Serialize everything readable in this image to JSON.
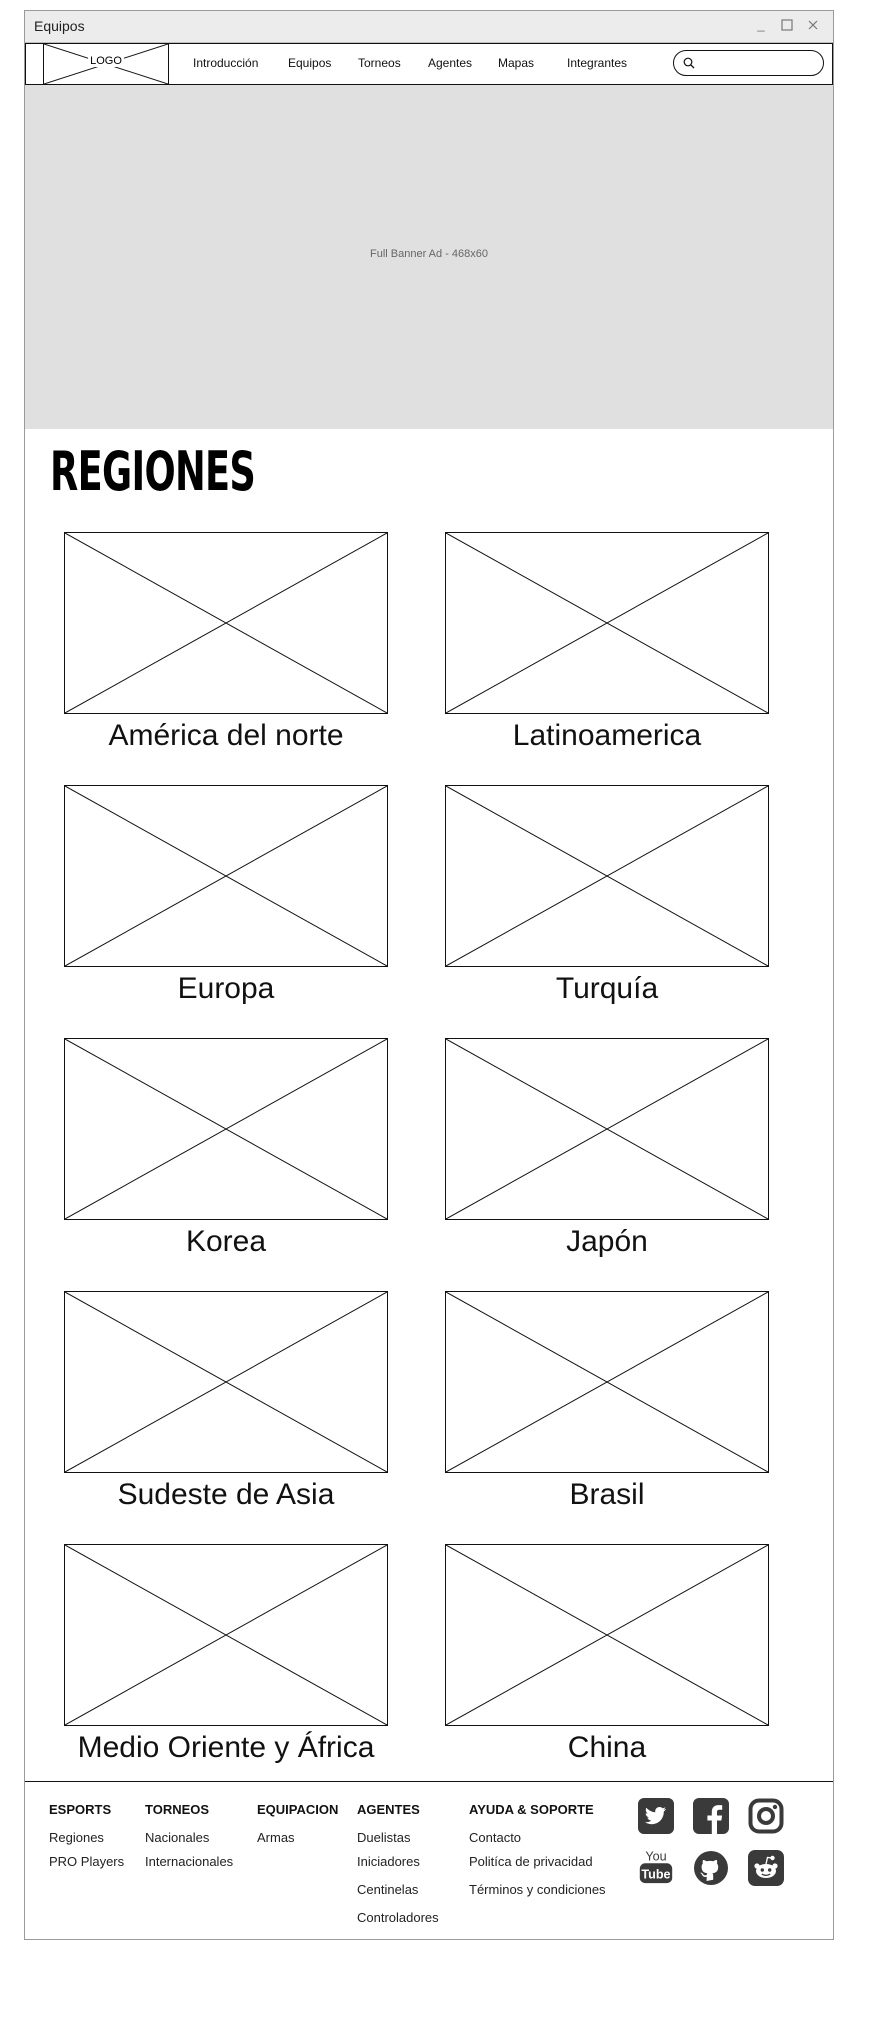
{
  "window": {
    "title": "Equipos"
  },
  "nav": {
    "logo": "LOGO",
    "links": [
      "Introducción",
      "Equipos",
      "Torneos",
      "Agentes",
      "Mapas",
      "Integrantes"
    ],
    "search_value": ""
  },
  "banner": {
    "text": "Full Banner Ad - 468x60"
  },
  "section": {
    "title": "REGIONES"
  },
  "regions": [
    "América del norte",
    "Latinoamerica",
    "Europa",
    "Turquía",
    "Korea",
    "Japón",
    "Sudeste de Asia",
    "Brasil",
    "Medio Oriente y África",
    "China"
  ],
  "footer": {
    "columns": [
      {
        "heading": "ESPORTS",
        "links": [
          "Regiones",
          "PRO Players"
        ]
      },
      {
        "heading": "TORNEOS",
        "links": [
          "Nacionales",
          "Internacionales"
        ]
      },
      {
        "heading": "EQUIPACION",
        "links": [
          "Armas"
        ]
      },
      {
        "heading": "AGENTES",
        "links": [
          "Duelistas",
          "Iniciadores",
          "Centinelas",
          "Controladores"
        ]
      },
      {
        "heading": "AYUDA & SOPORTE",
        "links": [
          "Contacto",
          "Politíca de privacidad",
          "Términos y condiciones"
        ]
      }
    ],
    "social_icons": [
      "twitter-icon",
      "facebook-icon",
      "instagram-icon",
      "youtube-icon",
      "github-icon",
      "reddit-icon"
    ],
    "youtube_text": [
      "You",
      "Tube"
    ]
  },
  "colors": {
    "banner": "#e0e0e0",
    "titlebar": "#ececec",
    "line": "#111111",
    "icon": "#3a3a3a"
  }
}
